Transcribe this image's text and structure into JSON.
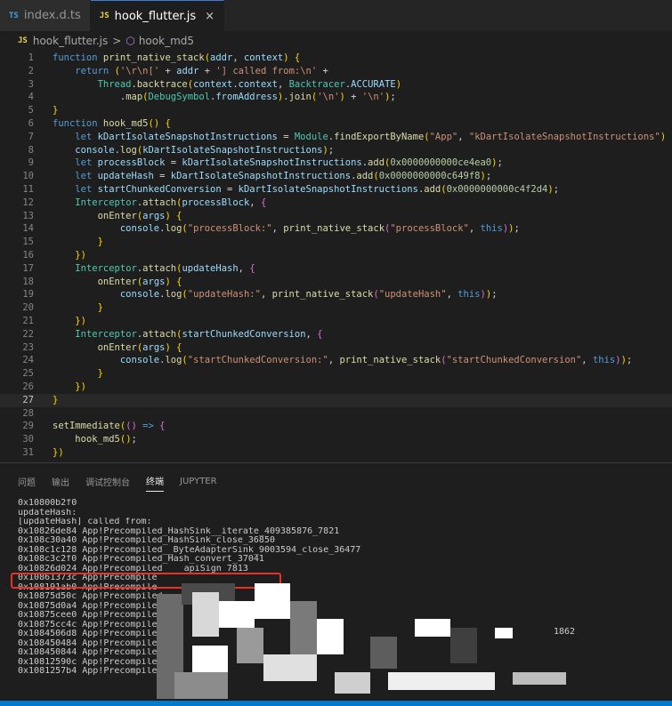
{
  "tabs": [
    {
      "badge": "TS",
      "label": "index.d.ts",
      "active": false
    },
    {
      "badge": "JS",
      "label": "hook_flutter.js",
      "active": true,
      "close": "×"
    }
  ],
  "breadcrumb": {
    "badge": "JS",
    "file": "hook_flutter.js",
    "separator": ">",
    "symbol": "hook_md5"
  },
  "editor": {
    "current_line": 27,
    "lines": [
      "function print_native_stack(addr, context) {",
      "    return ('\\r\\n[' + addr + '] called from:\\n' +",
      "        Thread.backtrace(context.context, Backtracer.ACCURATE)",
      "            .map(DebugSymbol.fromAddress).join('\\n') + '\\n');",
      "}",
      "function hook_md5() {",
      "    let kDartIsolateSnapshotInstructions = Module.findExportByName(\"App\", \"kDartIsolateSnapshotInstructions\")",
      "    console.log(kDartIsolateSnapshotInstructions);",
      "    let processBlock = kDartIsolateSnapshotInstructions.add(0x0000000000ce4ea0);",
      "    let updateHash = kDartIsolateSnapshotInstructions.add(0x0000000000c649f8);",
      "    let startChunkedConversion = kDartIsolateSnapshotInstructions.add(0x0000000000c4f2d4);",
      "    Interceptor.attach(processBlock, {",
      "        onEnter(args) {",
      "            console.log(\"processBlock:\", print_native_stack(\"processBlock\", this));",
      "        }",
      "    })",
      "    Interceptor.attach(updateHash, {",
      "        onEnter(args) {",
      "            console.log(\"updateHash:\", print_native_stack(\"updateHash\", this));",
      "        }",
      "    })",
      "    Interceptor.attach(startChunkedConversion, {",
      "        onEnter(args) {",
      "            console.log(\"startChunkedConversion:\", print_native_stack(\"startChunkedConversion\", this));",
      "        }",
      "    })",
      "}",
      "",
      "setImmediate(() => {",
      "    hook_md5();",
      "})"
    ]
  },
  "panel": {
    "tabs": [
      "问题",
      "输出",
      "调试控制台",
      "终端",
      "JUPYTER"
    ],
    "active_tab": "终端"
  },
  "terminal": {
    "lines": [
      "0x10800b2f0",
      "updateHash:",
      "[updateHash] called from:",
      "0x10826de84 App!Precompiled_HashSink__iterate_409385876_7821",
      "0x108c30a40 App!Precompiled_HashSink_close_36850",
      "0x108c1c128 App!Precompiled__ByteAdapterSink_9003594_close_36477",
      "0x108c3c2f0 App!Precompiled_Hash_convert_37041",
      "0x10826d024 App!Precompiled____apiSign_7813",
      "0x10861373c App!Precompile",
      "0x108191ab0 App!Precompile",
      "0x10875d50c App!Precompiled",
      "0x10875d0a4 App!Precompiled",
      "0x10875cee0 App!Precompiled",
      "0x10875cc4c App!Precompiled",
      "0x1084506d8 App!Precompiled",
      "0x108450484 App!Precompiled",
      "0x108450844 App!Precompiled",
      "0x10812590c App!Precompiled",
      "0x1081257b4 App!Precompiled"
    ],
    "visible_fragment": "1862"
  }
}
